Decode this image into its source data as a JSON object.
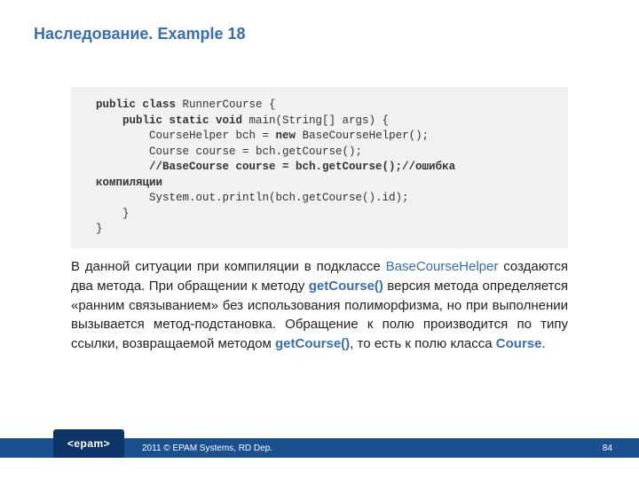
{
  "title": "Наследование. Example 18",
  "code": {
    "l1a": "public class",
    "l1b": " RunnerCourse {",
    "l2a": "    public static void",
    "l2b": " main(String[] args) {",
    "l3a": "        CourseHelper bch = ",
    "l3b": "new",
    "l3c": " BaseCourseHelper();",
    "l4": "        Course course = bch.getCourse();",
    "l5": "        //BaseCourse course = bch.getCourse();//ошибка",
    "l5x": "компиляции",
    "l6": "        System.out.println(bch.getCourse().id);",
    "l7": "    }",
    "l8": "}"
  },
  "para": {
    "p1": "В данной ситуации при компиляции в подклассе ",
    "h1": "BaseCourseHelper",
    "p2": " создаются два метода. При обращении к методу ",
    "h2": "getCourse()",
    "p3": " версия метода определяется «ранним связыванием» без использования полиморфизма, но при выполнении вызывается метод-подстановка. Обращение к полю производится по типу ссылки, возвращаемой методом ",
    "h3": "getCourse()",
    "p4": ", то есть к полю класса ",
    "h4": "Course",
    "p5": "."
  },
  "footer": {
    "logo": "<epam>",
    "copyright": "2011 © EPAM Systems, RD Dep.",
    "page": "84"
  }
}
